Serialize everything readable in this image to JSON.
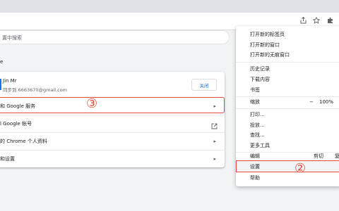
{
  "toolbar": {
    "icons": [
      "share-icon",
      "star-icon",
      "extensions-icon"
    ]
  },
  "search": {
    "placeholder": "置中搜索"
  },
  "section": {
    "title": "e"
  },
  "profile": {
    "name": "Jin Mr",
    "sync_status": "同步到 6663670@gmail.com",
    "close_label": "关闭"
  },
  "rows": [
    {
      "label": "和 Google 服务",
      "icon": "chevron-right-icon"
    },
    {
      "label": "l Google 帐号",
      "icon": "external-link-icon"
    },
    {
      "label": "的 Chrome 个人资料",
      "icon": "chevron-right-icon"
    },
    {
      "label": "和设置",
      "icon": "chevron-right-icon"
    }
  ],
  "annotations": {
    "circle3": "③",
    "circle2": "②",
    "accent": "#e24a3c"
  },
  "menu": {
    "items": {
      "new_tab": "打开新的标签页",
      "new_window": "打开新的窗口",
      "incognito": "打开新的无痕窗口",
      "history": "历史记录",
      "downloads": "下载内容",
      "bookmarks": "书签",
      "zoom": "缩放",
      "print": "打印...",
      "cast": "投放...",
      "find": "查找...",
      "more_tools": "更多工具",
      "edit": "编辑",
      "cut": "剪切",
      "copy": "复",
      "settings": "设置",
      "help": "帮助"
    },
    "zoom": {
      "minus": "−",
      "value": "100%"
    }
  }
}
